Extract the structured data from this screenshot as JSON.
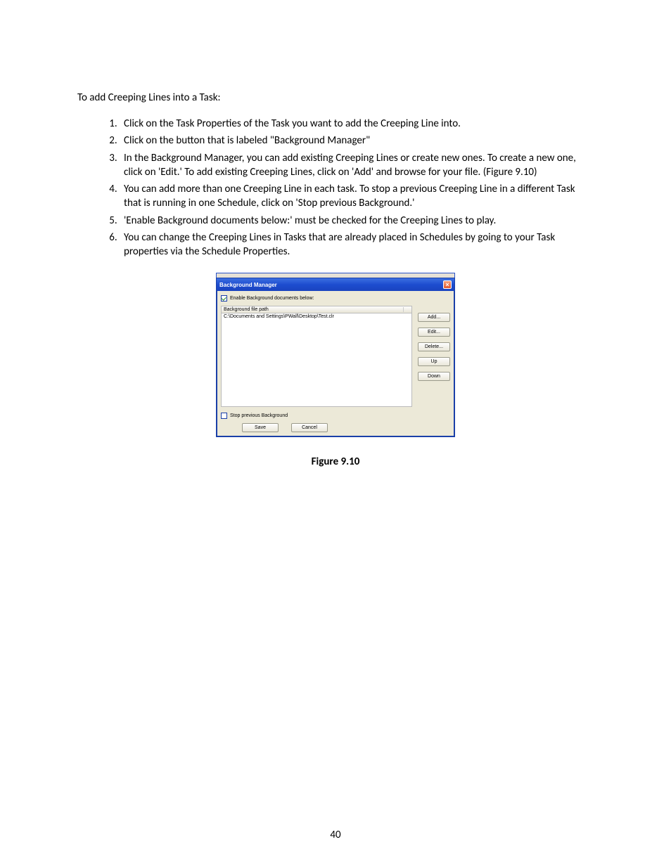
{
  "intro": "To add Creeping Lines into a Task:",
  "steps": [
    "Click on the Task Properties of the Task you want to add the Creeping Line into.",
    "Click on the button that is labeled \"Background Manager\"",
    "In the Background Manager, you can add existing Creeping Lines or create new ones. To create a new one, click on 'Edit.' To add existing Creeping Lines, click on 'Add' and browse for your file. (Figure 9.10)",
    "You can add more than one Creeping Line in each task. To stop a previous Creeping Line in a different Task that is running in one Schedule, click on 'Stop previous Background.'",
    "'Enable Background documents below:' must be checked for the Creeping Lines to play.",
    "You can change the Creeping Lines in Tasks that are already placed in Schedules by going to your Task properties via the Schedule Properties."
  ],
  "window": {
    "title": "Background Manager",
    "enable_label": "Enable Background documents below:",
    "enable_checked": true,
    "list_header": "Background file path",
    "list_item": "C:\\Documents and Settings\\PWall\\Desktop\\Test.clr",
    "buttons": {
      "add": "Add...",
      "edit": "Edit...",
      "delete": "Delete...",
      "up": "Up",
      "down": "Down"
    },
    "stop_label": "Stop previous Background",
    "stop_checked": false,
    "save": "Save",
    "cancel": "Cancel"
  },
  "caption": "Figure 9.10",
  "page_number": "40"
}
